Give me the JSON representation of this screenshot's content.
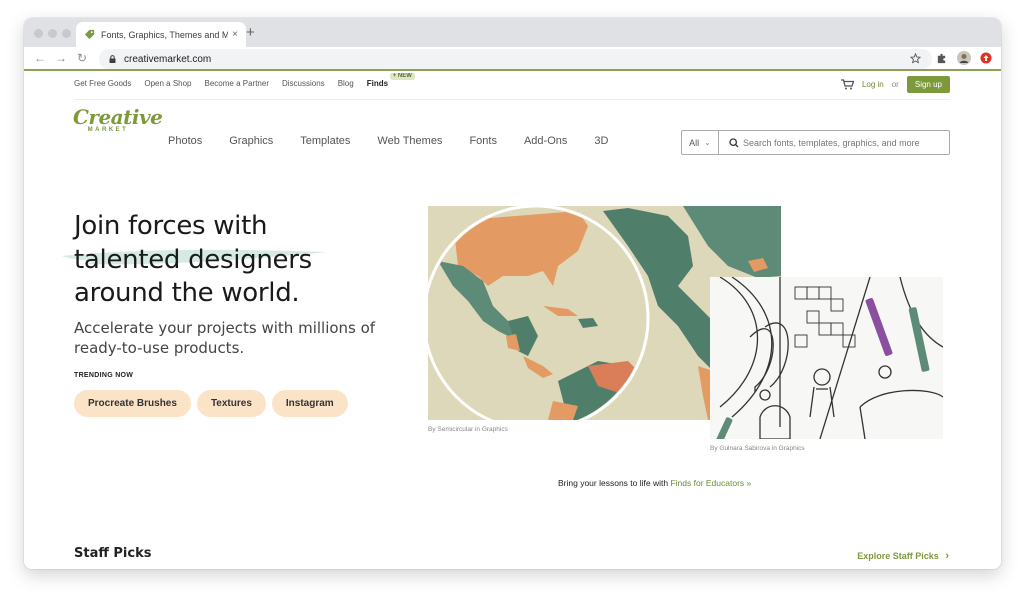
{
  "browser": {
    "tab_title": "Fonts, Graphics, Themes and M",
    "tab_close": "×",
    "new_tab": "+",
    "url": "creativemarket.com",
    "nav": {
      "back": "←",
      "forward": "→",
      "reload": "↻"
    }
  },
  "utility_nav": {
    "items": [
      "Get Free Goods",
      "Open a Shop",
      "Become a Partner",
      "Discussions",
      "Blog"
    ],
    "finds_label": "Finds",
    "finds_badge": "+ NEW",
    "login": "Log in",
    "or": "or",
    "signup": "Sign up"
  },
  "logo": {
    "line1": "Creative",
    "line2": "MARKET"
  },
  "main_nav": {
    "items": [
      "Photos",
      "Graphics",
      "Templates",
      "Web Themes",
      "Fonts",
      "Add-Ons",
      "3D"
    ]
  },
  "search": {
    "category": "All",
    "placeholder": "Search fonts, templates, graphics, and more"
  },
  "hero": {
    "title_line1": "Join forces with",
    "title_line2": "talented designers",
    "title_line3": "around the world.",
    "subtitle": "Accelerate your projects with millions of ready-to-use products.",
    "trending_label": "TRENDING NOW",
    "chips": [
      "Procreate Brushes",
      "Textures",
      "Instagram"
    ],
    "credit_map": "By Semicircular in Graphics",
    "credit_kids": "By Gulnara Sabirova in Graphics"
  },
  "promo": {
    "text": "Bring your lessons to life with ",
    "link": "Finds for Educators »"
  },
  "staff_picks": {
    "title": "Staff Picks",
    "explore": "Explore Staff Picks",
    "explore_icon": "›"
  },
  "colors": {
    "brand_green": "#7c9a3c",
    "chip_bg": "#fbe3c8",
    "map_teal": "#5e8b78",
    "map_orange": "#e39a63",
    "map_bg": "#ddd8b9"
  }
}
